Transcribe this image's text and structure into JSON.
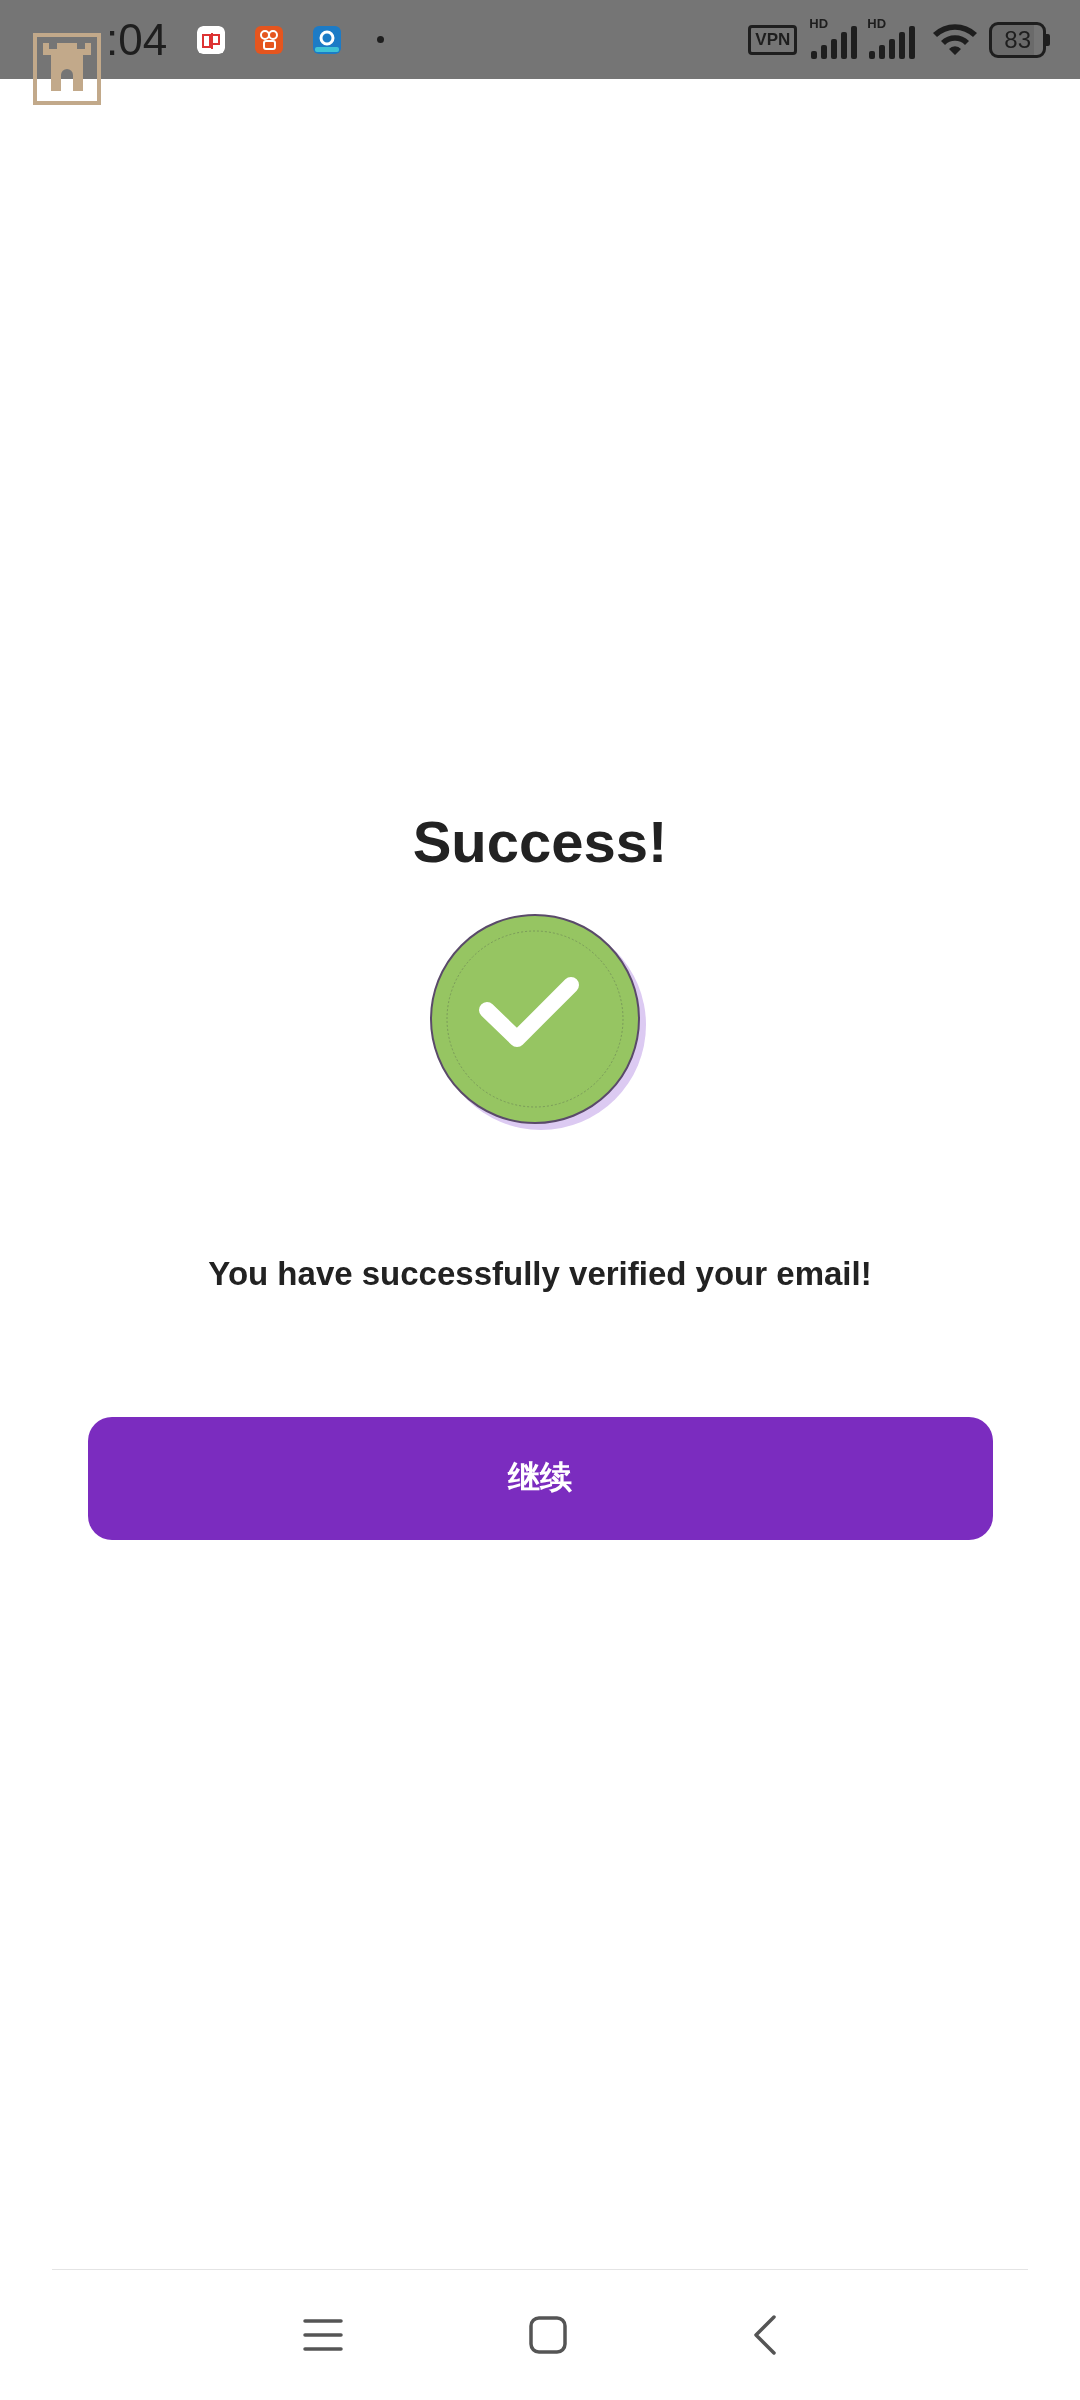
{
  "status_bar": {
    "time": ":04",
    "vpn": "VPN",
    "signals": [
      {
        "label": "HD"
      },
      {
        "label": "HD"
      }
    ],
    "battery": "83"
  },
  "title": "Success!",
  "message": "You have successfully verified your email!",
  "continue_button": {
    "label": "继续"
  }
}
